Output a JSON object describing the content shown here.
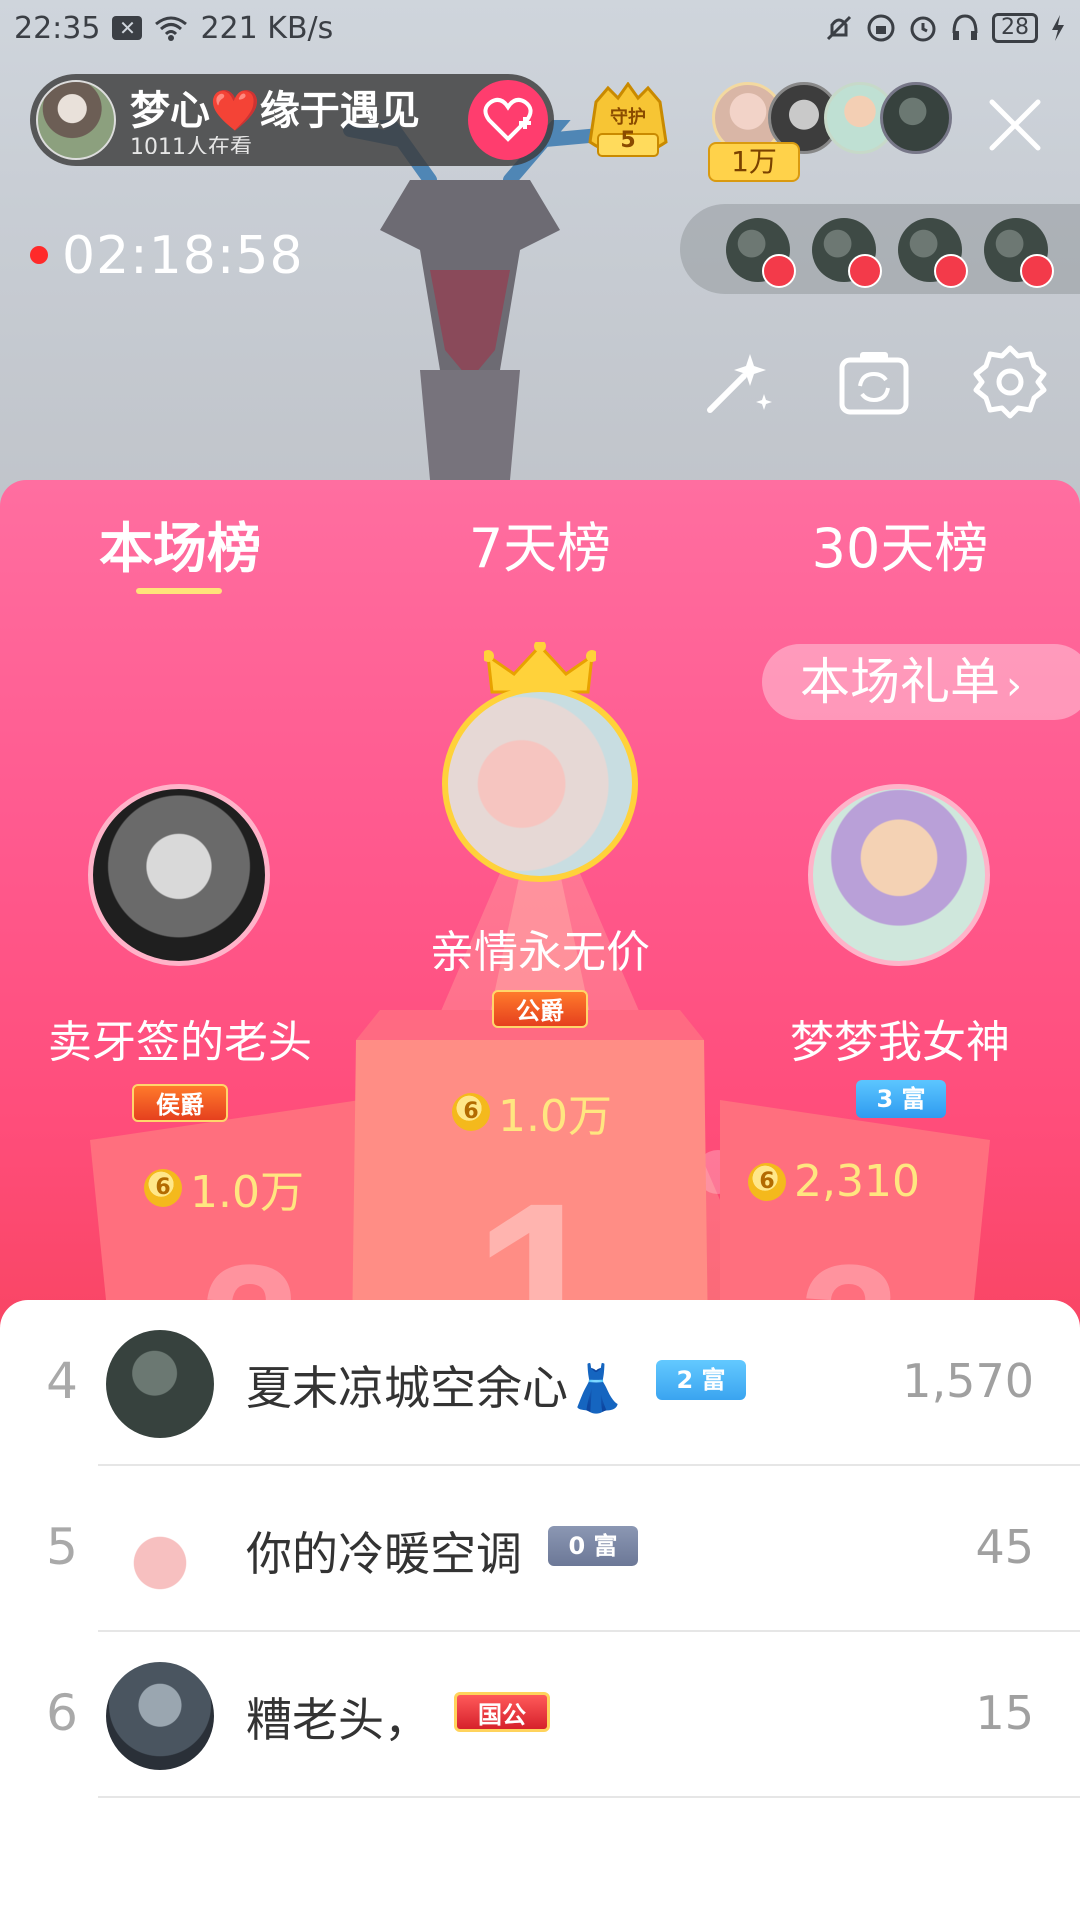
{
  "status_bar": {
    "time": "22:35",
    "net_speed": "221 KB/s",
    "battery": "28",
    "icons": [
      "notification-x-icon",
      "wifi-icon",
      "mute-icon",
      "rotation-lock-icon",
      "alarm-icon",
      "headset-icon",
      "battery-icon",
      "charging-icon"
    ]
  },
  "host": {
    "name": "梦心❤️缘于遇见",
    "viewers": "1011人在看"
  },
  "guard": {
    "label": "守护",
    "count": "5"
  },
  "top_viewers": {
    "coin_badge": "1万"
  },
  "live": {
    "timer": "02:18:58"
  },
  "ranking": {
    "tabs": [
      {
        "label": "本场榜",
        "active": true
      },
      {
        "label": "7天榜",
        "active": false
      },
      {
        "label": "30天榜",
        "active": false
      }
    ],
    "gift_list_label": "本场礼单",
    "podium": {
      "first": {
        "name": "亲情永无价",
        "title": "公爵",
        "score": "1.0万"
      },
      "second": {
        "name": "卖牙签的老头",
        "title": "侯爵",
        "score": "1.0万"
      },
      "third": {
        "name": "梦梦我女神",
        "title": "3 富",
        "score": "2,310"
      }
    },
    "coin_glyph": "6",
    "list": [
      {
        "rank": "4",
        "name": "夏末凉城空余心👗",
        "badge": "2 富",
        "score": "1,570"
      },
      {
        "rank": "5",
        "name": "你的冷暖空调",
        "badge": "0 富",
        "score": "45"
      },
      {
        "rank": "6",
        "name": "糟老头，",
        "badge": "国公",
        "score": "15"
      }
    ]
  },
  "colors": {
    "panel_top": "#ff6ea0",
    "panel_bottom": "#f84563",
    "underline": "#ffe37a",
    "score_gold": "#ffe680",
    "live_red": "#ff2a2a"
  }
}
